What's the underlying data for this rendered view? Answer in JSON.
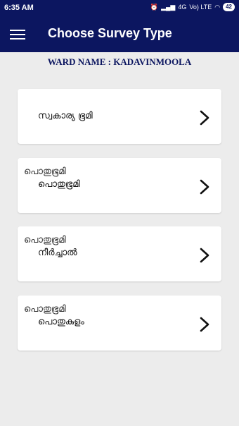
{
  "status": {
    "time": "6:35 AM",
    "network": "4G",
    "volte": "Vo) LTE",
    "battery": "42"
  },
  "appbar": {
    "title": "Choose Survey Type"
  },
  "ward": {
    "label": "WARD NAME : KADAVINMOOLA"
  },
  "items": [
    {
      "category": "",
      "name": "സ്വകാര്യ ഭൂമി"
    },
    {
      "category": "പൊതുഭൂമി",
      "name": "പൊതുഭൂമി"
    },
    {
      "category": "പൊതുഭൂമി",
      "name": "നീർച്ചാൽ"
    },
    {
      "category": "പൊതുഭൂമി",
      "name": "പൊതുകുളം"
    }
  ],
  "icons": {
    "menu": "hamburger-icon",
    "arrow": "chevron-right-icon"
  },
  "colors": {
    "primary": "#0c1660",
    "background": "#ececec",
    "card": "#ffffff"
  }
}
